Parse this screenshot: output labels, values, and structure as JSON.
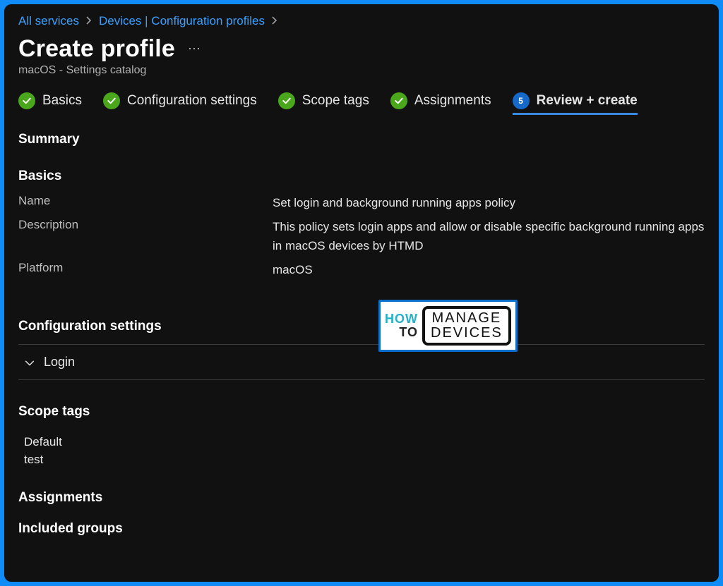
{
  "breadcrumb": {
    "all_services": "All services",
    "devices": "Devices | Configuration profiles"
  },
  "header": {
    "title": "Create profile",
    "subtitle": "macOS - Settings catalog"
  },
  "steps": {
    "basics": "Basics",
    "config": "Configuration settings",
    "scope": "Scope tags",
    "assignments": "Assignments",
    "review": "Review + create",
    "review_num": "5"
  },
  "sections": {
    "summary": "Summary",
    "basics": "Basics",
    "config_settings": "Configuration settings",
    "scope_tags": "Scope tags",
    "assignments": "Assignments",
    "included_groups": "Included groups"
  },
  "basics": {
    "name_label": "Name",
    "name_value": "Set login and background running apps policy",
    "desc_label": "Description",
    "desc_value": "This policy sets login apps and allow or disable specific background running apps in macOS devices by HTMD",
    "platform_label": "Platform",
    "platform_value": "macOS"
  },
  "config": {
    "login": "Login"
  },
  "scope_tags": [
    "Default",
    "test"
  ],
  "logo": {
    "how": "HOW",
    "to": "TO",
    "manage": "MANAGE",
    "devices": "DEVICES"
  }
}
